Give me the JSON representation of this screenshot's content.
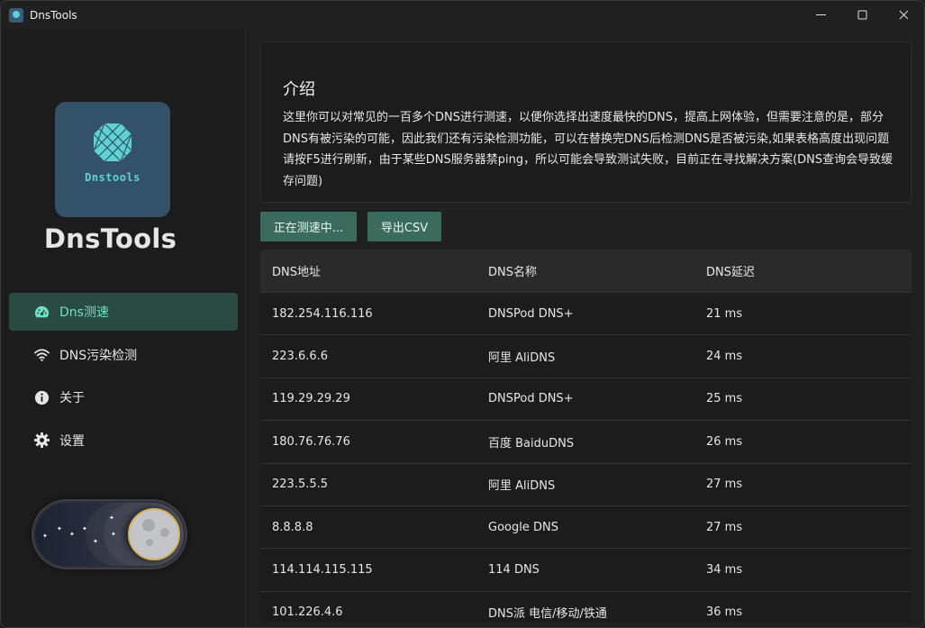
{
  "window": {
    "title": "DnsTools"
  },
  "sidebar": {
    "logo_text": "Dnstools",
    "app_name": "DnsTools",
    "items": [
      {
        "label": "Dns测速",
        "icon": "speedometer-icon",
        "active": true
      },
      {
        "label": "DNS污染检测",
        "icon": "wifi-icon",
        "active": false
      },
      {
        "label": "关于",
        "icon": "info-icon",
        "active": false
      },
      {
        "label": "设置",
        "icon": "gear-icon",
        "active": false
      }
    ]
  },
  "intro": {
    "title": "介绍",
    "body": "这里你可以对常见的一百多个DNS进行测速，以便你选择出速度最快的DNS，提高上网体验，但需要注意的是，部分DNS有被污染的可能，因此我们还有污染检测功能，可以在替换完DNS后检测DNS是否被污染,如果表格高度出现问题请按F5进行刷新，由于某些DNS服务器禁ping，所以可能会导致测试失败，目前正在寻找解决方案(DNS查询会导致缓存问题)"
  },
  "toolbar": {
    "test_label": "正在测速中...",
    "csv_label": "导出CSV"
  },
  "table": {
    "headers": [
      "DNS地址",
      "DNS名称",
      "DNS延迟"
    ],
    "rows": [
      [
        "182.254.116.116",
        "DNSPod DNS+",
        "21 ms"
      ],
      [
        "223.6.6.6",
        "阿里 AliDNS",
        "24 ms"
      ],
      [
        "119.29.29.29",
        "DNSPod DNS+",
        "25 ms"
      ],
      [
        "180.76.76.76",
        "百度 BaiduDNS",
        "26 ms"
      ],
      [
        "223.5.5.5",
        "阿里 AliDNS",
        "27 ms"
      ],
      [
        "8.8.8.8",
        "Google DNS",
        "27 ms"
      ],
      [
        "114.114.115.115",
        "114 DNS",
        "34 ms"
      ],
      [
        "101.226.4.6",
        "DNS派 电信/移动/铁通",
        "36 ms"
      ]
    ]
  },
  "theme": {
    "accent": "#6fe0c4",
    "button_bg": "#3b6b5c",
    "active_nav_bg": "#2a4a44"
  }
}
